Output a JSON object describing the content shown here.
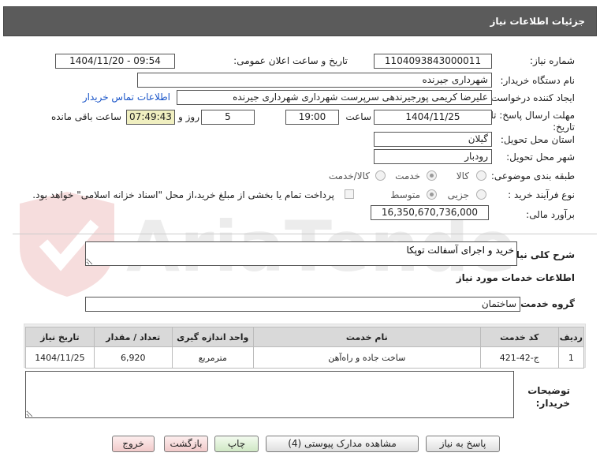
{
  "header": {
    "title": "جزئیات اطلاعات نیاز"
  },
  "need": {
    "number_label": "شماره نیاز:",
    "number_value": "1104093843000011",
    "announce_label": "تاریخ و ساعت اعلان عمومی:",
    "announce_value": "1404/11/20 - 09:54",
    "buyer_label": "نام دستگاه خریدار:",
    "buyer_value": "شهرداری جیرنده",
    "creator_label": "ایجاد کننده درخواست:",
    "creator_value": "علیرضا کریمی پورجیرندهی سرپرست شهرداری شهرداری جیرنده",
    "contact_link": "اطلاعات تماس خریدار",
    "deadline_label_1": "مهلت ارسال پاسخ: تا",
    "deadline_label_2": "تاریخ:",
    "deadline_date": "1404/11/25",
    "time_label": "ساعت",
    "deadline_time": "19:00",
    "days_value": "5",
    "days_label": "روز و",
    "remaining_time": "07:49:43",
    "remaining_label": "ساعت باقی مانده",
    "province_label": "استان محل تحویل:",
    "province_value": "گیلان",
    "city_label": "شهر محل تحویل:",
    "city_value": "رودبار",
    "category_label": "طبقه بندی موضوعی:",
    "category_options": [
      "کالا",
      "خدمت",
      "کالا/خدمت"
    ],
    "process_label": "نوع فرآیند خرید :",
    "process_options": [
      "جزیی",
      "متوسط"
    ],
    "payment_note": "پرداخت تمام یا بخشی از مبلغ خرید،از محل \"اسناد خزانه اسلامی\" خواهد بود.",
    "estimate_label": "برآورد مالی:",
    "estimate_value": "16,350,670,736,000"
  },
  "general": {
    "desc_label": "شرح کلی نیاز:",
    "desc_value": "خرید و اجرای آسفالت توپکا",
    "services_heading": "اطلاعات خدمات مورد نیاز",
    "group_label": "گروه خدمت:",
    "group_value": "ساختمان"
  },
  "table": {
    "headers": [
      "ردیف",
      "کد خدمت",
      "نام خدمت",
      "واحد اندازه گیری",
      "تعداد / مقدار",
      "تاریخ نیاز"
    ],
    "rows": [
      [
        "1",
        "ج-42-421",
        "ساخت جاده و راه‌آهن",
        "مترمربع",
        "6,920",
        "1404/11/25"
      ]
    ]
  },
  "buyer_notes": {
    "label_1": "توضیحات",
    "label_2": "خریدار:"
  },
  "buttons": {
    "respond": "پاسخ به نیاز",
    "attachments": "مشاهده مدارک پیوستی (4)",
    "print": "چاپ",
    "back": "بازگشت",
    "exit": "خروج"
  },
  "watermark": {
    "text": "AriaTender.neT"
  }
}
